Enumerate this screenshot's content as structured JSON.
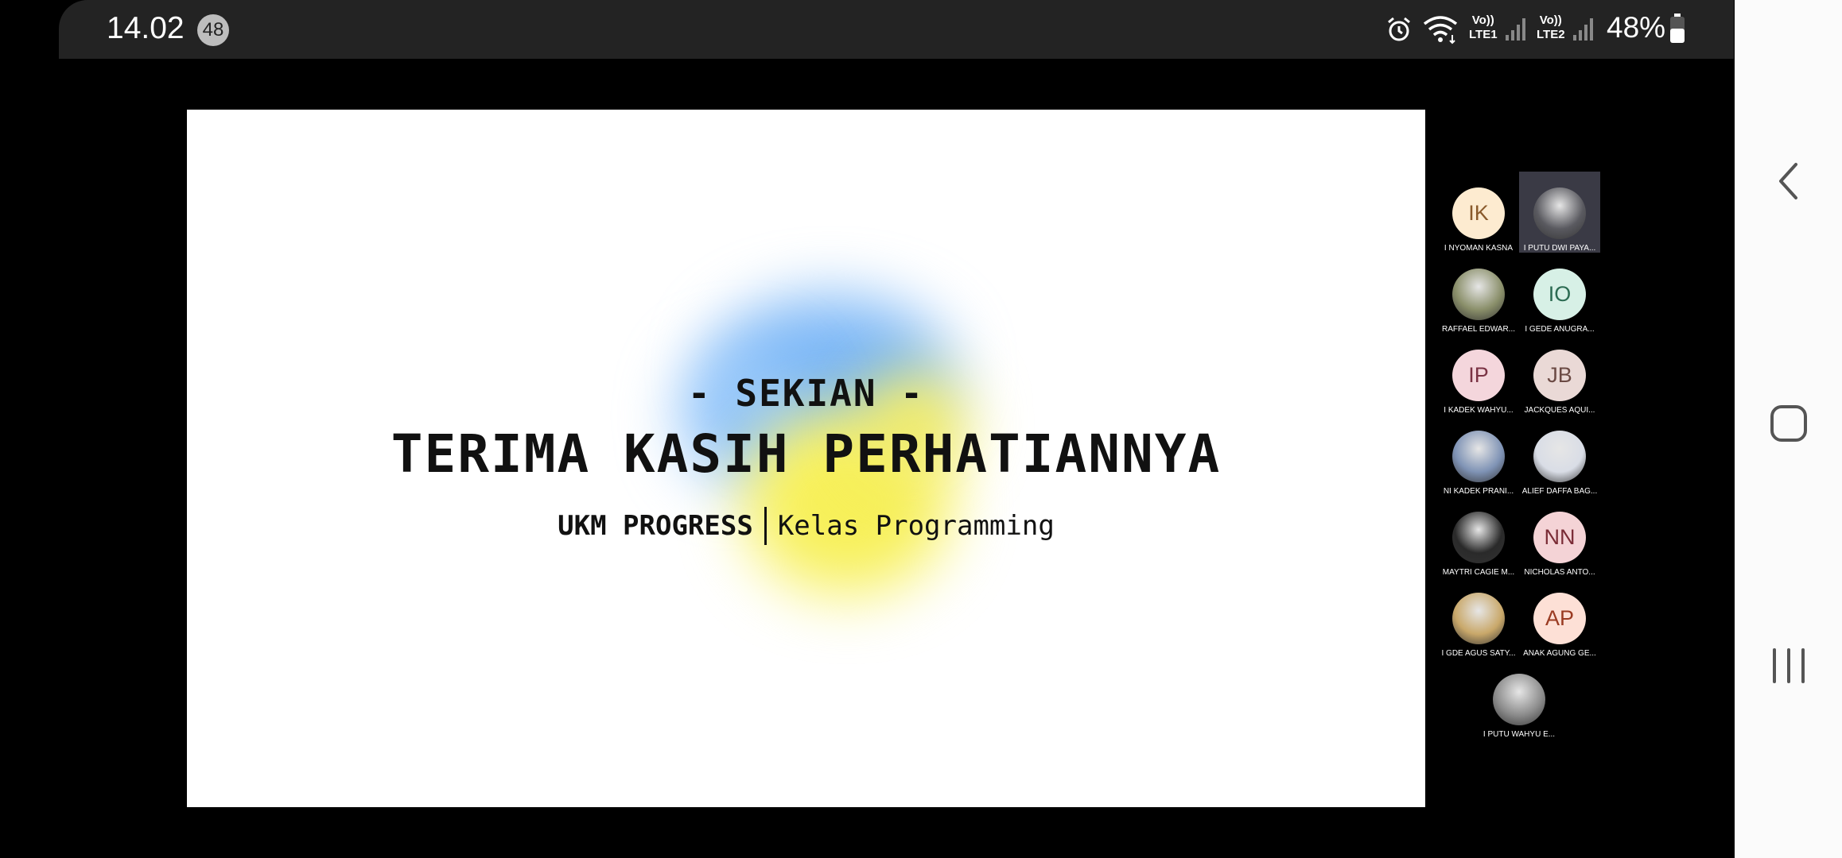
{
  "status_bar": {
    "time": "14.02",
    "notification_count": "48",
    "sim1": {
      "volte": "Vo))",
      "network": "LTE1"
    },
    "sim2": {
      "volte": "Vo))",
      "network": "LTE2"
    },
    "battery": "48%",
    "icons": [
      "alarm-icon",
      "wifi-icon",
      "signal-icon",
      "signal-icon",
      "battery-icon"
    ]
  },
  "slide": {
    "subtitle": "- SEKIAN -",
    "title": "TERIMA KASIH PERHATIANNYA",
    "org": "UKM PROGRESS",
    "class_name": "Kelas Programming"
  },
  "participants": [
    {
      "initials": "IK",
      "name": "I NYOMAN KASNA",
      "bg": "#fdebd0",
      "fg": "#8a5a2b",
      "photo": false
    },
    {
      "initials": "",
      "name": "I PUTU DWI PAYA...",
      "bg": "#5a5a60",
      "fg": "#ffffff",
      "photo": true,
      "active": true
    },
    {
      "initials": "",
      "name": "RAFFAEL EDWAR...",
      "bg": "#8a8f6a",
      "fg": "#ffffff",
      "photo": true
    },
    {
      "initials": "IO",
      "name": "I GEDE ANUGRA...",
      "bg": "#d7f0e6",
      "fg": "#2c6b52",
      "photo": false
    },
    {
      "initials": "IP",
      "name": "I KADEK WAHYU...",
      "bg": "#f4d6dc",
      "fg": "#7a3344",
      "photo": false
    },
    {
      "initials": "JB",
      "name": "JACKQUES AQUI...",
      "bg": "#ead9d6",
      "fg": "#6b4a44",
      "photo": false
    },
    {
      "initials": "",
      "name": "NI KADEK PRANI...",
      "bg": "#7f93b5",
      "fg": "#ffffff",
      "photo": true
    },
    {
      "initials": "",
      "name": "ALIEF DAFFA BAG...",
      "bg": "#d9dde6",
      "fg": "#ffffff",
      "photo": true
    },
    {
      "initials": "",
      "name": "MAYTRI CAGIE M...",
      "bg": "#2a2a2a",
      "fg": "#ffffff",
      "photo": true
    },
    {
      "initials": "NN",
      "name": "NICHOLAS ANTO...",
      "bg": "#f4d3d6",
      "fg": "#7a2c36",
      "photo": false
    },
    {
      "initials": "",
      "name": "I GDE AGUS SATY...",
      "bg": "#c9a86a",
      "fg": "#ffffff",
      "photo": true
    },
    {
      "initials": "AP",
      "name": "ANAK AGUNG GE...",
      "bg": "#fde0d6",
      "fg": "#9a3b22",
      "photo": false
    },
    {
      "initials": "",
      "name": "I PUTU WAHYU E...",
      "bg": "#8c8c8c",
      "fg": "#ffffff",
      "photo": true
    }
  ],
  "nav": {
    "back": "back-icon",
    "home": "home-icon",
    "recents": "recents-icon"
  }
}
